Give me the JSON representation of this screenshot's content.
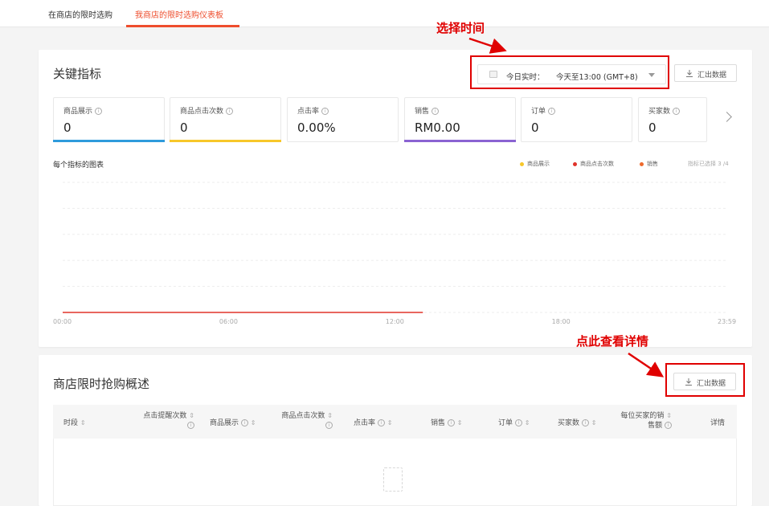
{
  "tabs": [
    {
      "label": "在商店的限时选购"
    },
    {
      "label": "我商店的限时选购仪表板",
      "active": true
    }
  ],
  "key_metrics": {
    "title": "关键指标",
    "date_picker": {
      "label": "今日实时：",
      "value": "今天至13:00 (GMT+8)"
    },
    "export_label": "汇出数据",
    "metrics": [
      {
        "label": "商品展示",
        "value": "0",
        "bar_color": "#2f9bdc"
      },
      {
        "label": "商品点击次数",
        "value": "0",
        "bar_color": "#f7c72a"
      },
      {
        "label": "点击率",
        "value": "0.00%",
        "bar_color": "#ffffff"
      },
      {
        "label": "销售",
        "value": "RM0.00",
        "bar_color": "#8a63d2"
      },
      {
        "label": "订单",
        "value": "0",
        "bar_color": "#ffffff"
      },
      {
        "label": "买家数",
        "value": "0",
        "bar_color": "#ffffff"
      }
    ],
    "chart_title": "每个指标的图表",
    "legend": [
      {
        "name": "商品展示",
        "color": "#f7c72a"
      },
      {
        "name": "商品点击次数",
        "color": "#e0332a"
      },
      {
        "name": "销售",
        "color": "#ee6a2d"
      }
    ],
    "legend_count": "指标已选择 3 /4"
  },
  "chart_data": {
    "type": "line",
    "x_ticks": [
      "00:00",
      "06:00",
      "12:00",
      "18:00",
      "23:59"
    ],
    "x_range": [
      "00:00",
      "23:59"
    ],
    "series_end": "13:00",
    "y_values": [
      0,
      0
    ],
    "grid": true,
    "legend_position": "top-right"
  },
  "overview": {
    "title": "商店限时抢购概述",
    "export_label": "汇出数据",
    "columns": [
      {
        "label": "时段"
      },
      {
        "label_l1": "点击提醒次数",
        "label_l2": ""
      },
      {
        "label": "商品展示"
      },
      {
        "label_l1": "商品点击次数",
        "label_l2": ""
      },
      {
        "label": "点击率"
      },
      {
        "label": "销售"
      },
      {
        "label": "订单"
      },
      {
        "label": "买家数"
      },
      {
        "label_l1": "每位买家的销",
        "label_l2": "售额"
      },
      {
        "label": "详情"
      }
    ]
  },
  "annotations": {
    "select_time": "选择时间",
    "click_details": "点此查看详情"
  },
  "colors": {
    "accent": "#ee4d2d",
    "annotation": "#e00000"
  }
}
